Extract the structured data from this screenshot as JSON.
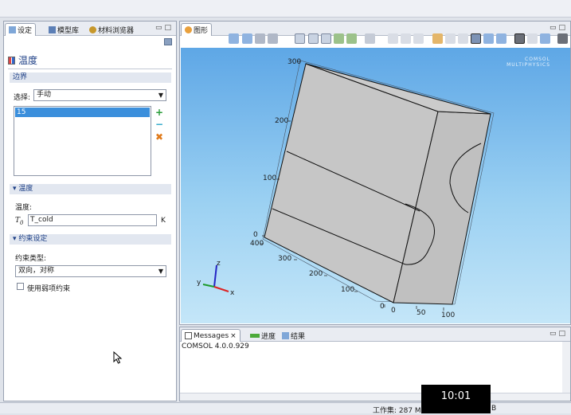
{
  "left_panel": {
    "tabs": [
      {
        "label": "设定"
      },
      {
        "label": "模型库"
      },
      {
        "label": "材料浏览器"
      }
    ],
    "title": "温度",
    "boundary": {
      "section_label": "边界",
      "selection_label": "选择:",
      "selection_value": "手动",
      "list_items": [
        "15"
      ]
    },
    "temperature": {
      "section_label": "温度",
      "field_label": "温度:",
      "symbol": "T",
      "subscript": "0",
      "value": "T_cold",
      "unit": "K"
    },
    "constraint": {
      "section_label": "约束设定",
      "type_label": "约束类型:",
      "type_value": "双向，对称",
      "checkbox_label": "使用弱项约束"
    }
  },
  "graphics": {
    "tab_label": "图形",
    "watermark": "COMSOL MULTIPHYSICS",
    "ticks": {
      "z": [
        "300",
        "200",
        "100",
        "0"
      ],
      "y": [
        "400",
        "300",
        "200",
        "100",
        "0"
      ],
      "x": [
        "0",
        "50",
        "100"
      ]
    },
    "triad": {
      "x": "x",
      "y": "y",
      "z": "z"
    }
  },
  "messages": {
    "tabs": [
      {
        "label": "Messages"
      },
      {
        "label": "进度"
      },
      {
        "label": "结果"
      }
    ],
    "content": "COMSOL 4.0.0.929"
  },
  "status": {
    "memory": "工作集: 287 M",
    "tail": "B"
  },
  "overlay": {
    "clock": "10:01"
  },
  "colors": {
    "accent_blue": "#1d3f86",
    "selection": "#3b8fdc",
    "model_face": "#c6c6c6",
    "add": "#2a9d3a",
    "remove": "#2aa6c9",
    "delete": "#e07a1a"
  }
}
